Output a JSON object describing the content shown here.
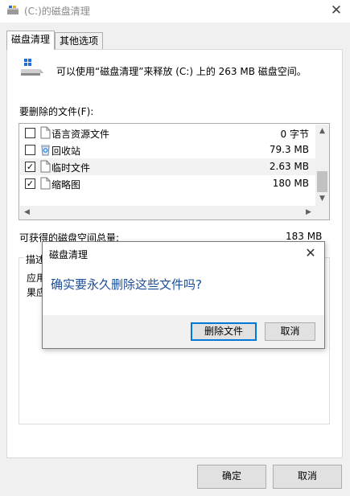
{
  "window": {
    "title": "(C:)的磁盘清理",
    "close_glyph": "✕"
  },
  "tabs": [
    {
      "label": "磁盘清理",
      "active": true
    },
    {
      "label": "其他选项",
      "active": false
    }
  ],
  "summary": {
    "text": "可以使用“磁盘清理”来释放 (C:) 上的 263 MB 磁盘空间。"
  },
  "files": {
    "label": "要删除的文件(F):",
    "items": [
      {
        "name": "语言资源文件",
        "size": "0 字节",
        "checked": false,
        "icon": "file-icon"
      },
      {
        "name": "回收站",
        "size": "79.3 MB",
        "checked": false,
        "icon": "recycle-bin-icon"
      },
      {
        "name": "临时文件",
        "size": "2.63 MB",
        "checked": true,
        "icon": "file-icon"
      },
      {
        "name": "缩略图",
        "size": "180 MB",
        "checked": true,
        "icon": "file-icon"
      }
    ],
    "check_glyph": "✓",
    "scroll_up": "▲",
    "scroll_down": "▼",
    "scroll_left": "◀",
    "scroll_right": "▶"
  },
  "space": {
    "label": "可获得的磁盘空间总量:",
    "value": "183 MB"
  },
  "description": {
    "title": "描述",
    "line1": "应用",
    "line2": "果应"
  },
  "buttons": {
    "ok": "确定",
    "cancel": "取消"
  },
  "dialog": {
    "title": "磁盘清理",
    "close_glyph": "✕",
    "message": "确实要永久删除这些文件吗?",
    "delete_label": "删除文件",
    "cancel_label": "取消"
  },
  "colors": {
    "accent": "#0078d7",
    "message": "#1a4d9a"
  }
}
